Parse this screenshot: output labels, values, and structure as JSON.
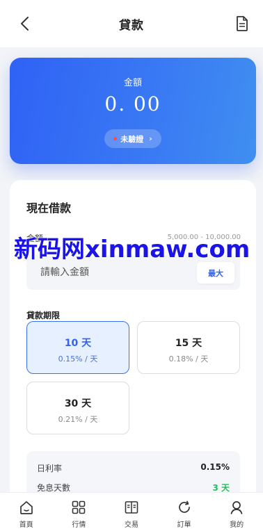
{
  "header": {
    "title": "貸款",
    "back_icon": "chevron-left-icon",
    "doc_icon": "document-icon"
  },
  "amount_card": {
    "label": "金額",
    "value": "0. 00",
    "verify_status": "未驗證",
    "verify_arrow": "›",
    "status_dot_color": "#ff4d3d"
  },
  "loan": {
    "section_title": "現在借款",
    "amount_label": "金額",
    "amount_range": "5,000.00 - 10,000.00",
    "amount_placeholder": "請輸入金額",
    "amount_value": "",
    "max_button": "最大",
    "term_label": "貸款期限",
    "terms": [
      {
        "days": "10 天",
        "rate": "0.15% / 天",
        "selected": true
      },
      {
        "days": "15 天",
        "rate": "0.18% / 天",
        "selected": false
      },
      {
        "days": "30 天",
        "rate": "0.21% / 天",
        "selected": false
      }
    ]
  },
  "summary": [
    {
      "label": "日利率",
      "value": "0.15%"
    },
    {
      "label": "免息天數",
      "value": "3 天"
    }
  ],
  "watermark": "新码网xinmaw.com",
  "tabbar": [
    {
      "label": "首頁",
      "icon": "home-icon"
    },
    {
      "label": "行情",
      "icon": "grid-icon"
    },
    {
      "label": "交易",
      "icon": "book-icon"
    },
    {
      "label": "訂單",
      "icon": "refresh-icon"
    },
    {
      "label": "我的",
      "icon": "user-icon"
    }
  ],
  "colors": {
    "primary": "#2f62f5",
    "green": "#1ec25a",
    "background": "#f3f4f7"
  }
}
